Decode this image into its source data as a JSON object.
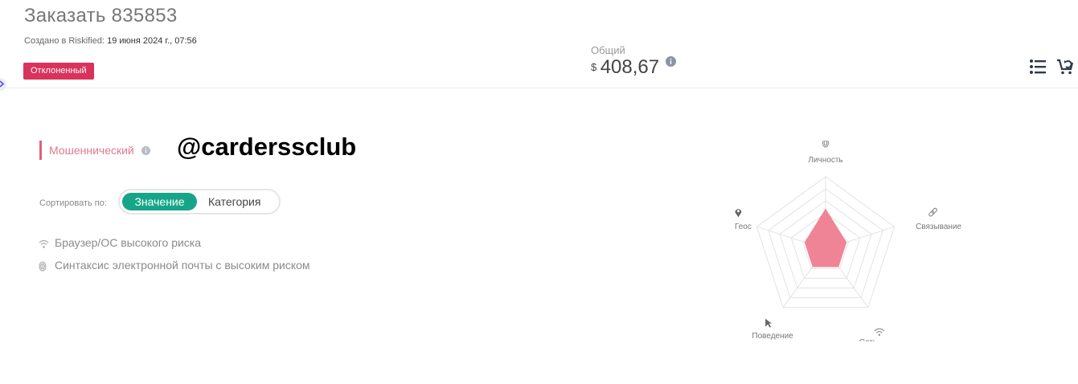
{
  "order": {
    "title": "Заказать 835853",
    "created_prefix": "Создано в Riskified:",
    "created_value": "19 июня 2024 г., 07:56",
    "status": "Отклоненный",
    "status_color": "#d9325b"
  },
  "total": {
    "label": "Общий",
    "currency": "$",
    "amount": "408,67"
  },
  "header_icons": [
    "list-icon",
    "cart-return-icon"
  ],
  "analysis": {
    "verdict": "Мошеннический",
    "verdict_color": "#e0607a",
    "watermark": "@carderssclub",
    "sort_label": "Сортировать по:",
    "sort_options": [
      "Значение",
      "Категория"
    ],
    "sort_selected": "Значение",
    "accent_color": "#17a589",
    "reasons": [
      {
        "icon": "wifi-icon",
        "text": "Браузер/ОС высокого риска"
      },
      {
        "icon": "fingerprint-icon",
        "text": "Синтаксис электронной почты с высоким риском"
      }
    ]
  },
  "radar": {
    "axes": [
      {
        "label": "Личность",
        "icon": "fingerprint-icon",
        "value": 0.55
      },
      {
        "label": "Связывание",
        "icon": "link-icon",
        "value": 0.3
      },
      {
        "label": "Сеть",
        "icon": "wifi-icon",
        "value": 0.3
      },
      {
        "label": "Поведение",
        "icon": "cursor-icon",
        "value": 0.3
      },
      {
        "label": "Геос",
        "icon": "location-pin-icon",
        "value": 0.3
      }
    ],
    "fill_color": "#f08497"
  }
}
